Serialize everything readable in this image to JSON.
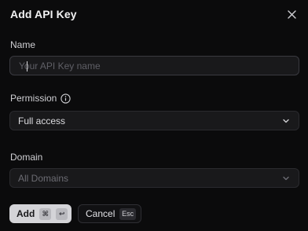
{
  "dialog": {
    "title": "Add API Key",
    "close_icon": "close-icon"
  },
  "name": {
    "label": "Name",
    "value": "",
    "placeholder": "Your API Key name"
  },
  "permission": {
    "label": "Permission",
    "info_icon": "info-circle-icon",
    "selected": "Full access"
  },
  "domain": {
    "label": "Domain",
    "selected": "All Domains"
  },
  "actions": {
    "add_label": "Add",
    "add_shortcut_cmd": "⌘",
    "add_shortcut_enter": "↩",
    "cancel_label": "Cancel",
    "cancel_shortcut": "Esc"
  },
  "colors": {
    "background": "#0b0b0c",
    "field_bg": "#19191b",
    "primary_button": "#d4d4d8"
  }
}
